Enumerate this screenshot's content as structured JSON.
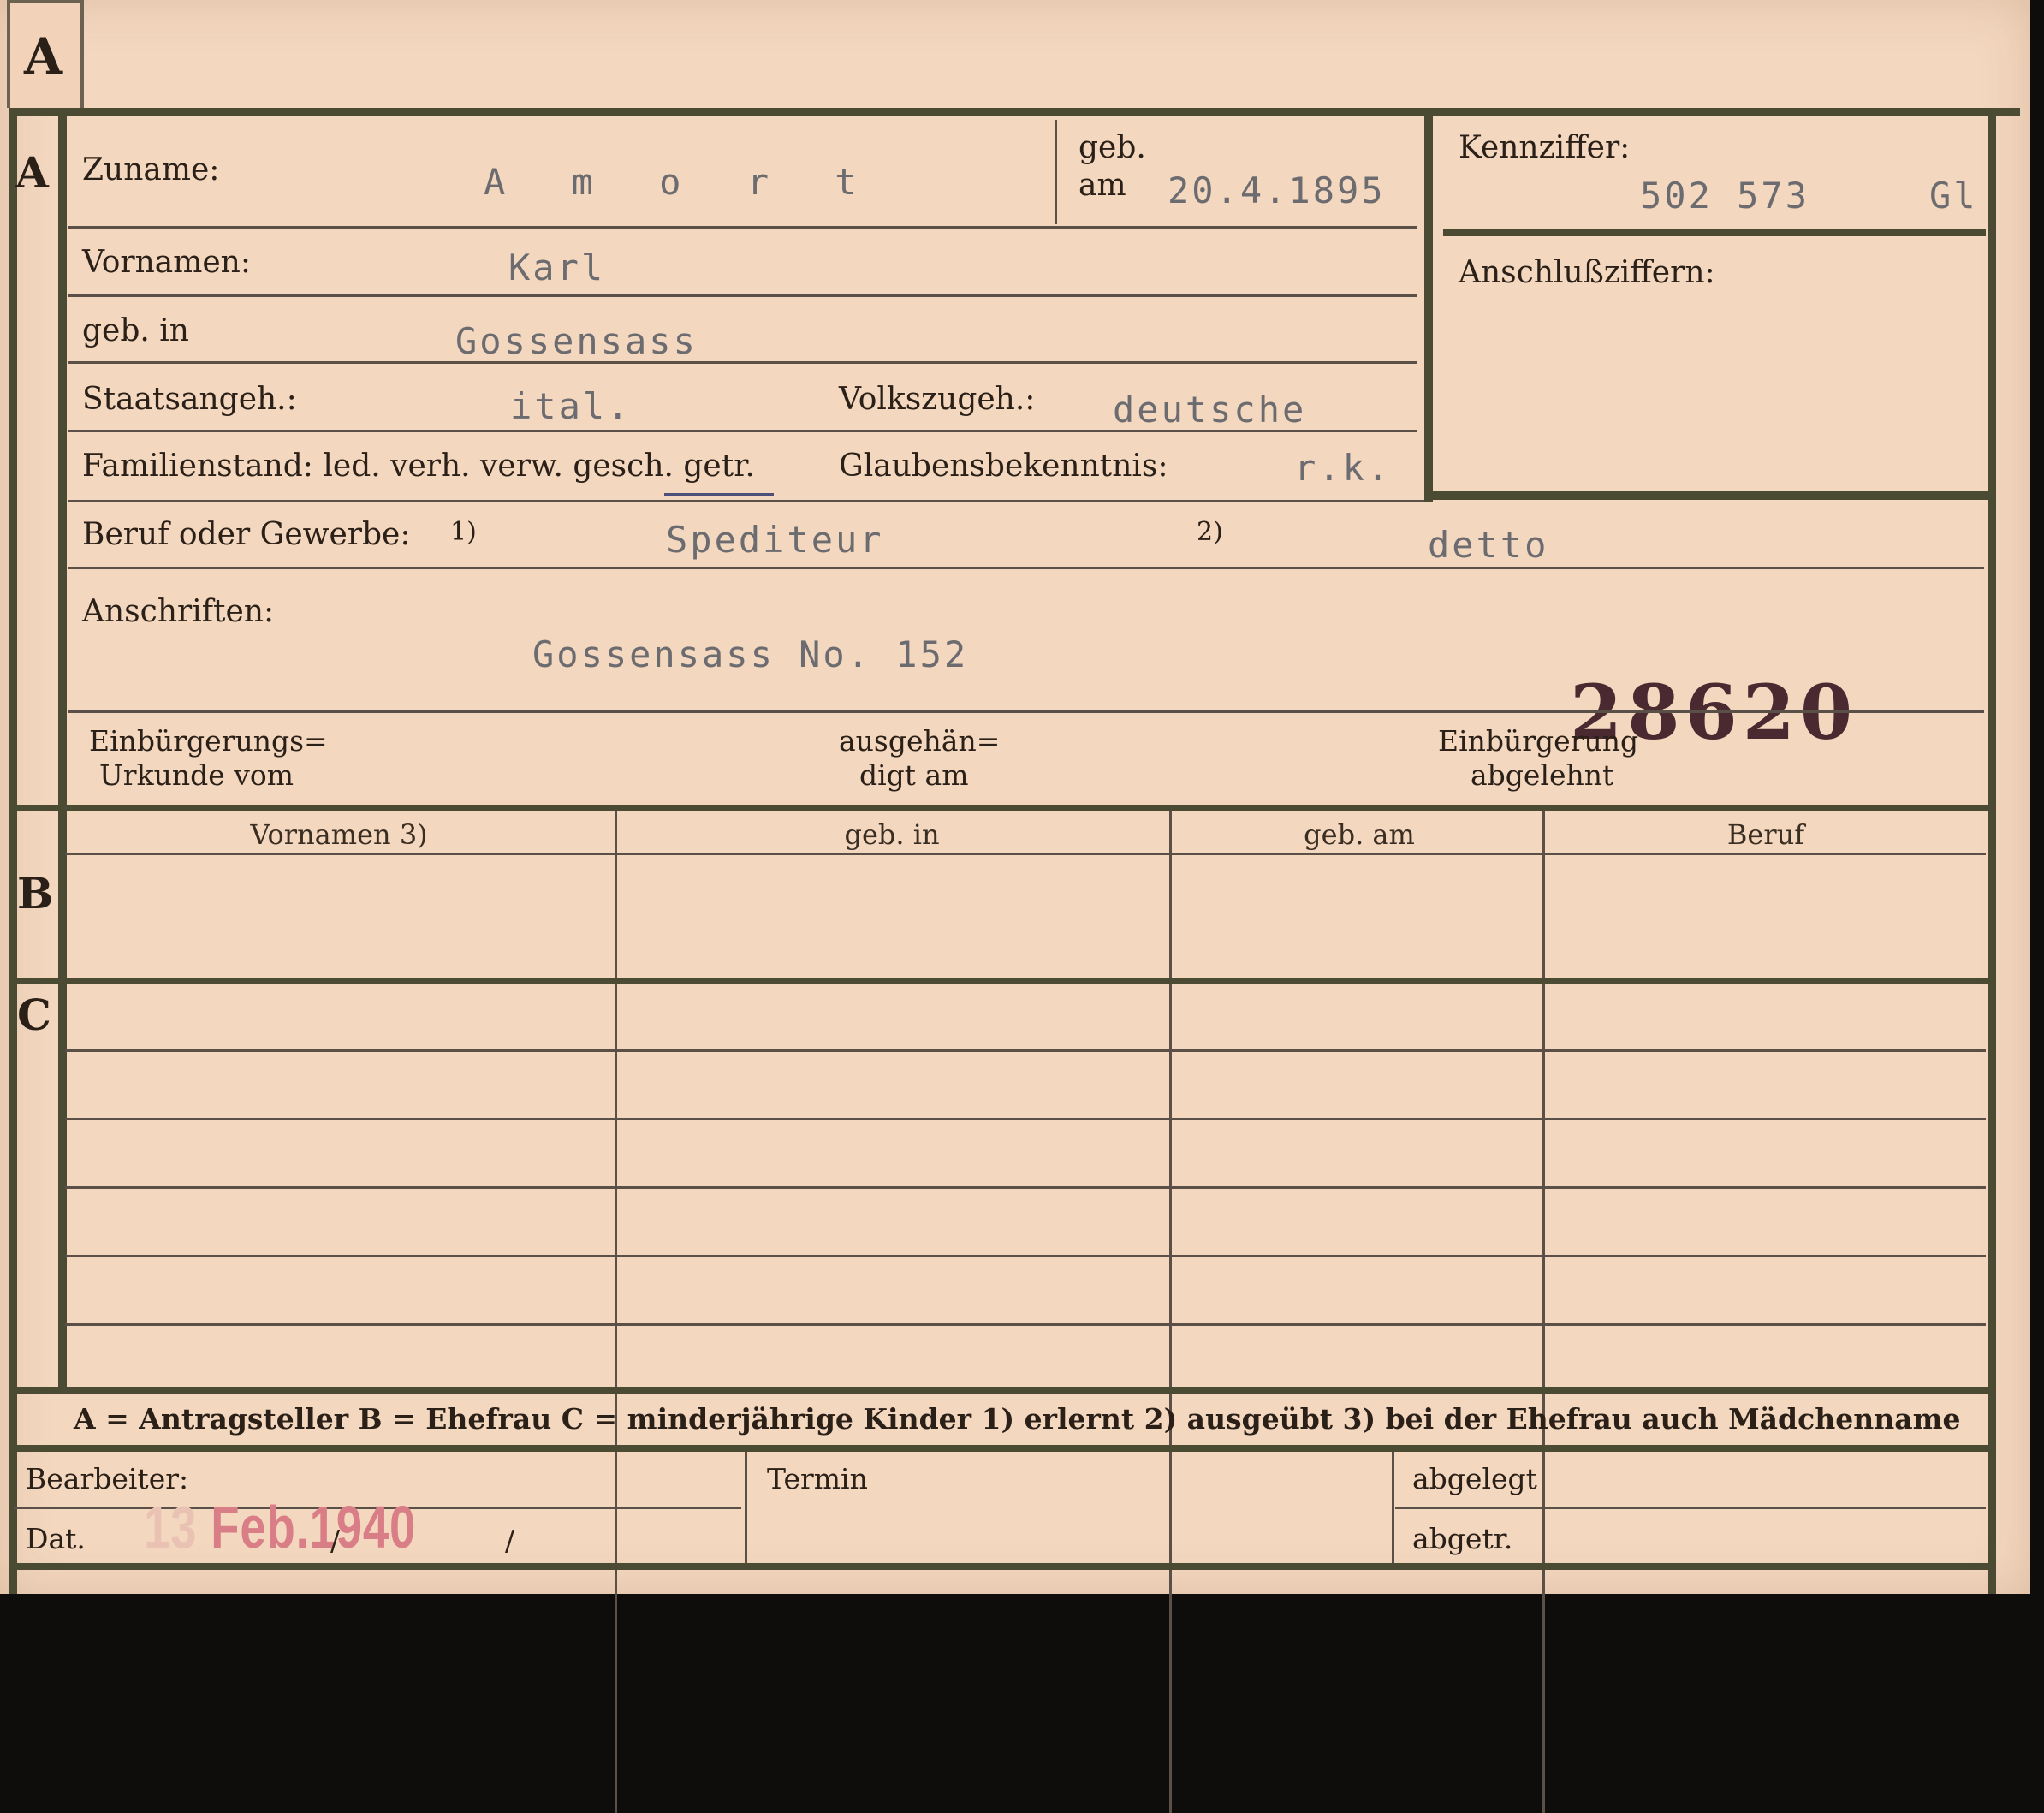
{
  "card": {
    "section_labels": {
      "a": "A",
      "b": "B",
      "c": "C"
    },
    "tab_letter": "A",
    "header": {
      "surname_label": "Zuname:",
      "surname_value": "A m o r t",
      "born_label_1": "geb.",
      "born_label_2": "am",
      "born_value": "20.4.1895",
      "kennziffer_label": "Kennziffer:",
      "kennziffer_value": "502 573",
      "kennziffer_suffix": "Gl",
      "anschluss_label": "Anschlußziffern:"
    },
    "fields": {
      "vornamen_label": "Vornamen:",
      "vornamen_value": "Karl",
      "geb_in_label": "geb. in",
      "geb_in_value": "Gossensass",
      "staatsangeh_label": "Staatsangeh.:",
      "staatsangeh_value": "ital.",
      "volkszugeh_label": "Volkszugeh.:",
      "volkszugeh_value": "deutsche",
      "familienstand_label": "Familienstand: led. verh. verw. gesch. getr.",
      "glaubens_label": "Glaubensbekenntnis:",
      "glaubens_value": "r.k.",
      "beruf_label": "Beruf oder Gewerbe:",
      "beruf_note1": "1)",
      "beruf_value1": "Spediteur",
      "beruf_note2": "2)",
      "beruf_value2": "detto",
      "anschriften_label": "Anschriften:",
      "anschriften_value": "Gossensass No. 152",
      "stamp_number": "28620",
      "einb_label_1": "Einbürgerungs=",
      "einb_label_2": "Urkunde vom",
      "ausgeh_label_1": "ausgehän=",
      "ausgeh_label_2": "digt am",
      "abgelehnt_label_1": "Einbürgerung",
      "abgelehnt_label_2": "abgelehnt"
    },
    "table_b": {
      "columns": [
        "Vornamen 3)",
        "geb. in",
        "geb. am",
        "Beruf"
      ]
    },
    "legend": "A = Antragsteller   B = Ehefrau   C = minderjährige Kinder   1) erlernt   2) ausgeübt   3) bei der Ehefrau auch Mädchenname",
    "footer": {
      "bearbeiter_label": "Bearbeiter:",
      "dat_label": "Dat.",
      "date_stamp_day": "13",
      "date_stamp_rest": "Feb.1940",
      "slash1": "/",
      "slash2": "/",
      "termin_label": "Termin",
      "abgelegt_label": "abgelegt",
      "abgetr_label": "abgetr."
    }
  }
}
